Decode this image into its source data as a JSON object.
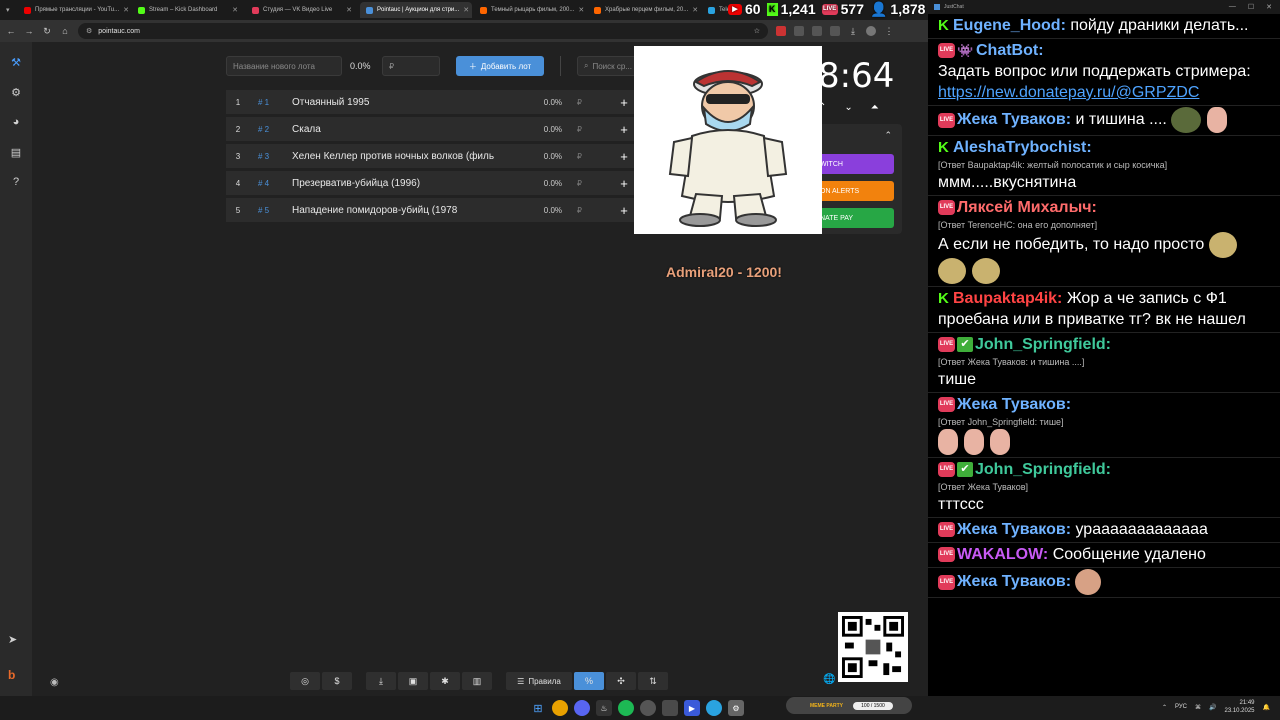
{
  "browser": {
    "tabs": [
      {
        "label": "Прямые трансляции - YouTu...",
        "color": "#e00",
        "active": false
      },
      {
        "label": "Stream – Kick Dashboard",
        "color": "#53fc18",
        "active": false
      },
      {
        "label": "Студия — VK Видео Live",
        "color": "#e13b5a",
        "active": false
      },
      {
        "label": "Pointauc | Аукцион для стри...",
        "color": "#4a90d9",
        "active": true
      },
      {
        "label": "Темный рыцарь фильм, 200...",
        "color": "#f60",
        "active": false
      },
      {
        "label": "Храбрые перцем фильм, 20...",
        "color": "#f60",
        "active": false
      },
      {
        "label": "Teleg...",
        "color": "#2aa3e0",
        "active": false
      }
    ],
    "url": "pointauc.com"
  },
  "overlay_counters": {
    "youtube": "60",
    "kick": "1,241",
    "vk": "577",
    "total": "1,878"
  },
  "auction": {
    "lot_placeholder": "Название нового лота",
    "percent": "0.0%",
    "rub_placeholder": "₽",
    "add_button": "Добавить лот",
    "search_placeholder": "Поиск ср...",
    "lots": [
      {
        "num": "1",
        "hash": "# 1",
        "title": "Отчаянный 1995",
        "percent": "0.0%",
        "rub": "₽"
      },
      {
        "num": "2",
        "hash": "# 2",
        "title": "Скала",
        "percent": "0.0%",
        "rub": "₽"
      },
      {
        "num": "3",
        "hash": "# 3",
        "title": "Хелен Келлер против ночных волков (филь",
        "percent": "0.0%",
        "rub": "₽"
      },
      {
        "num": "4",
        "hash": "# 4",
        "title": "Презерватив-убийца (1996)",
        "percent": "0.0%",
        "rub": "₽"
      },
      {
        "num": "5",
        "hash": "# 5",
        "title": "Нападение помидоров-убийц (1978",
        "percent": "0.0%",
        "rub": "₽"
      }
    ],
    "timer": "8:64",
    "donate_buttons": {
      "twitch": "WITCH",
      "donationalerts": "ON ALERTS",
      "donatepay": "NATE PAY"
    },
    "admiral_text": "Admiral20 - 1200!",
    "bottom_rules": "Правила",
    "bottom_percent": "%"
  },
  "chat": {
    "title": "JustChat",
    "messages": [
      {
        "badge": "kick",
        "nick": "Eugene_Hood:",
        "color": "#6fb2ff",
        "text": "пойду драники делать..."
      },
      {
        "badge": "live-bot",
        "nick": "ChatBot:",
        "color": "#6fb2ff",
        "text": "Задать вопрос или поддержать стримера:",
        "link": "https://new.donatepay.ru/@GRPZDC"
      },
      {
        "badge": "live",
        "nick": "Жека Туваков:",
        "color": "#6fb2ff",
        "text": "и тишина ...."
      },
      {
        "badge": "kick",
        "nick": "AleshaTrybochist:",
        "color": "#6fb2ff",
        "reply": "[Ответ Baupaktap4ik: желтый полосатик и сыр косичка]",
        "text": "ммм.....вкуснятина"
      },
      {
        "badge": "live",
        "nick": "Ляксей Михалыч:",
        "color": "#ff6b6b",
        "reply": "[Ответ TerenceHC: она его дополняет]",
        "text": "А если не победить, то надо просто"
      },
      {
        "badge": "kick",
        "nick": "Baupaktap4ik:",
        "color": "#ff4444",
        "text": "Жор а че запись с Ф1 проебана или в приватке тг? вк не нашел"
      },
      {
        "badge": "live-check",
        "nick": "John_Springfield:",
        "color": "#3fc99b",
        "reply": "[Ответ Жека Туваков: и тишина ....]",
        "text": "тише"
      },
      {
        "badge": "live",
        "nick": "Жека Туваков:",
        "color": "#6fb2ff",
        "reply": "[Ответ John_Springfield: тише]",
        "text": ""
      },
      {
        "badge": "live-check",
        "nick": "John_Springfield:",
        "color": "#3fc99b",
        "reply": "[Ответ Жека Туваков]",
        "text": "тттссс"
      },
      {
        "badge": "live",
        "nick": "Жека Туваков:",
        "color": "#6fb2ff",
        "text": "урааааааааааааа"
      },
      {
        "badge": "live",
        "nick": "WAKALOW:",
        "color": "#c85af5",
        "text": "Сообщение удалено"
      },
      {
        "badge": "live",
        "nick": "Жека Туваков:",
        "color": "#6fb2ff",
        "text": ""
      }
    ]
  },
  "taskbar": {
    "meme_party_label": "MEME PARTY",
    "meme_party_progress": "100 / 1500",
    "lang": "РУС",
    "time": "21:49",
    "date": "23.10.2025"
  }
}
